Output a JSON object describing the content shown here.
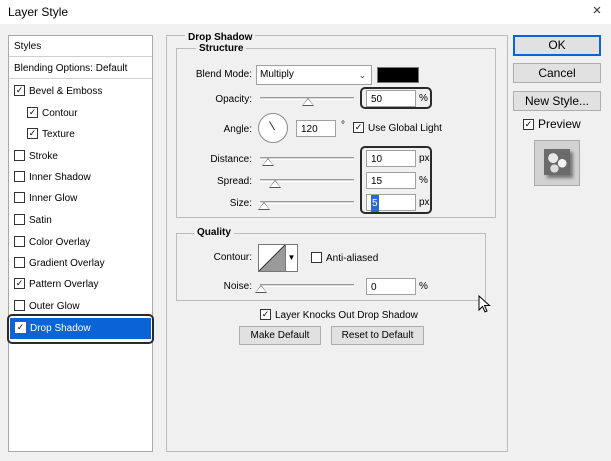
{
  "window": {
    "title": "Layer Style",
    "close_glyph": "×"
  },
  "styles_list": {
    "header": "Styles",
    "blending_options": "Blending Options: Default",
    "items": [
      {
        "label": "Bevel & Emboss",
        "checked": true
      },
      {
        "label": "Contour",
        "checked": true
      },
      {
        "label": "Texture",
        "checked": true
      },
      {
        "label": "Stroke",
        "checked": false
      },
      {
        "label": "Inner Shadow",
        "checked": false
      },
      {
        "label": "Inner Glow",
        "checked": false
      },
      {
        "label": "Satin",
        "checked": false
      },
      {
        "label": "Color Overlay",
        "checked": false
      },
      {
        "label": "Gradient Overlay",
        "checked": false
      },
      {
        "label": "Pattern Overlay",
        "checked": true
      },
      {
        "label": "Outer Glow",
        "checked": false
      },
      {
        "label": "Drop Shadow",
        "checked": true,
        "selected": true
      }
    ]
  },
  "drop_shadow": {
    "title": "Drop Shadow",
    "structure": {
      "title": "Structure",
      "blend_mode_label": "Blend Mode:",
      "blend_mode_value": "Multiply",
      "shadow_color": "#000000",
      "opacity_label": "Opacity:",
      "opacity_value": "50",
      "opacity_unit": "%",
      "angle_label": "Angle:",
      "angle_value": "120",
      "angle_unit": "°",
      "use_global_light_label": "Use Global Light",
      "use_global_light_checked": true,
      "distance_label": "Distance:",
      "distance_value": "10",
      "distance_unit": "px",
      "spread_label": "Spread:",
      "spread_value": "15",
      "spread_unit": "%",
      "size_label": "Size:",
      "size_value": "5",
      "size_unit": "px"
    },
    "quality": {
      "title": "Quality",
      "contour_label": "Contour:",
      "anti_aliased_label": "Anti-aliased",
      "anti_aliased_checked": false,
      "noise_label": "Noise:",
      "noise_value": "0",
      "noise_unit": "%"
    },
    "layer_knocks_out_label": "Layer Knocks Out Drop Shadow",
    "layer_knocks_out_checked": true,
    "make_default_label": "Make Default",
    "reset_default_label": "Reset to Default"
  },
  "buttons": {
    "ok": "OK",
    "cancel": "Cancel",
    "new_style": "New Style...",
    "preview_label": "Preview",
    "preview_checked": true
  },
  "colors": {
    "selection": "#0a64d8",
    "highlight_ring": "#2a2a2a"
  }
}
